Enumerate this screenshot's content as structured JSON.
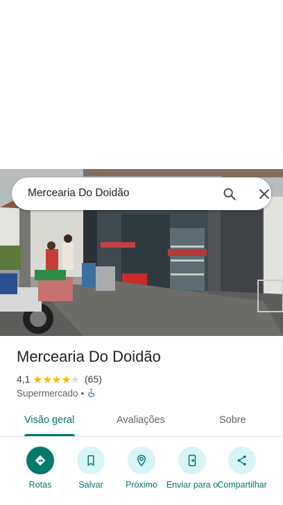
{
  "search": {
    "query": "Mercearia Do Doidão"
  },
  "place": {
    "name": "Mercearia Do Doidão",
    "rating": "4,1",
    "stars": 4.1,
    "review_count": "(65)",
    "category": "Supermercado",
    "separator": "•"
  },
  "tabs": [
    {
      "label": "Visão geral",
      "active": true
    },
    {
      "label": "Avaliações",
      "active": false
    },
    {
      "label": "Sobre",
      "active": false
    }
  ],
  "actions": [
    {
      "label": "Rotas",
      "icon": "directions-icon"
    },
    {
      "label": "Salvar",
      "icon": "bookmark-icon"
    },
    {
      "label": "Próximo",
      "icon": "nearby-icon"
    },
    {
      "label": "Enviar para o",
      "icon": "send-to-phone-icon"
    },
    {
      "label": "Compartilhar",
      "icon": "share-icon"
    }
  ],
  "colors": {
    "accent": "#00796b",
    "action_bg": "#d7f4f6",
    "star": "#fbbc04",
    "accessibility": "#1a73e8"
  }
}
